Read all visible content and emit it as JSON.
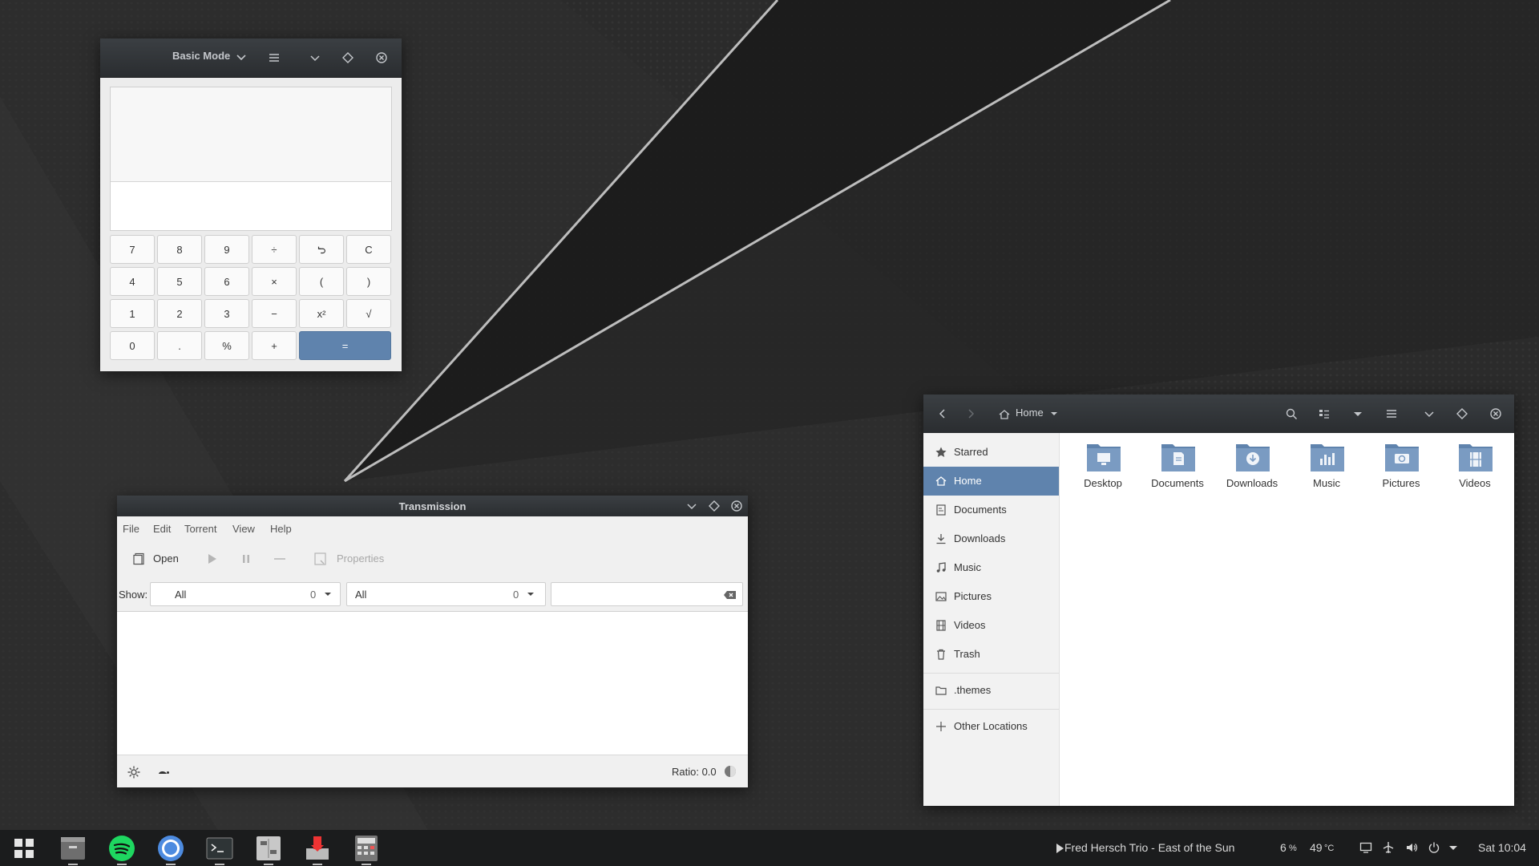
{
  "colors": {
    "accent": "#5f83ad",
    "header_dark": "#2d3033",
    "taskbar": "#1b1c1d"
  },
  "calculator": {
    "mode_label": "Basic Mode",
    "keys": [
      "7",
      "8",
      "9",
      "÷",
      "undo",
      "C",
      "4",
      "5",
      "6",
      "×",
      "(",
      ")",
      "1",
      "2",
      "3",
      "−",
      "x²",
      "√",
      "0",
      ".",
      "%",
      "+",
      "="
    ]
  },
  "transmission": {
    "title": "Transmission",
    "menu": [
      "File",
      "Edit",
      "Torrent",
      "View",
      "Help"
    ],
    "toolbar": {
      "open": "Open",
      "properties": "Properties"
    },
    "filter": {
      "show_label": "Show:",
      "activity": {
        "value": "All",
        "count": "0"
      },
      "category": {
        "value": "All",
        "count": "0"
      },
      "search_value": ""
    },
    "status": {
      "ratio": "Ratio: 0.0"
    }
  },
  "files": {
    "location": "Home",
    "sidebar": [
      "Starred",
      "Home",
      "Documents",
      "Downloads",
      "Music",
      "Pictures",
      "Videos",
      "Trash",
      ".themes",
      "Other Locations"
    ],
    "active": "Home",
    "folders": [
      "Desktop",
      "Documents",
      "Downloads",
      "Music",
      "Pictures",
      "Videos"
    ]
  },
  "taskbar": {
    "now_playing": "Fred Hersch Trio - East of the Sun",
    "cpu": "6",
    "cpu_unit": "%",
    "temp": "49",
    "temp_unit": "°C",
    "clock": "Sat 10:04",
    "apps": [
      "app-grid-icon",
      "files-icon",
      "spotify-icon",
      "chromium-icon",
      "terminal-icon",
      "settings-icon",
      "transmission-icon",
      "calculator-icon"
    ]
  }
}
